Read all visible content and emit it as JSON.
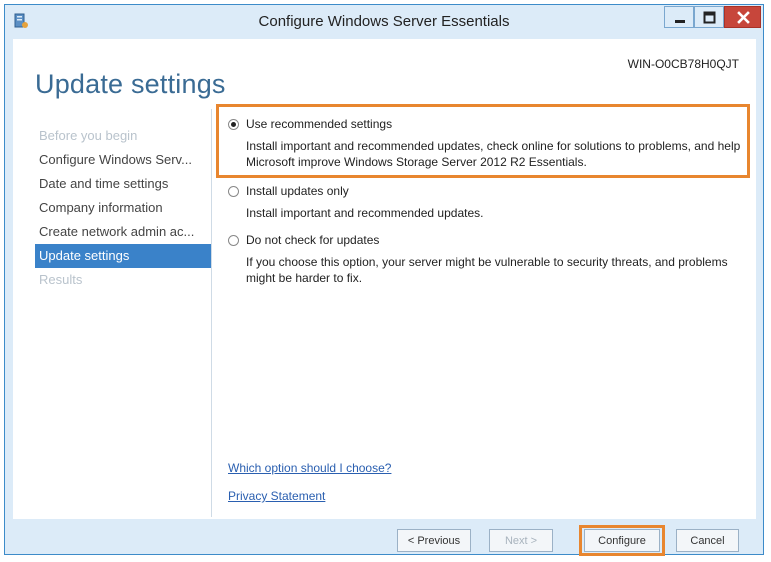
{
  "window": {
    "title": "Configure Windows Server Essentials"
  },
  "header": {
    "page_title": "Update settings",
    "server_name": "WIN-O0CB78H0QJT"
  },
  "nav": {
    "items": [
      {
        "label": "Before you begin",
        "state": "disabled"
      },
      {
        "label": "Configure Windows Serv...",
        "state": "normal"
      },
      {
        "label": "Date and time settings",
        "state": "normal"
      },
      {
        "label": "Company information",
        "state": "normal"
      },
      {
        "label": "Create network admin ac...",
        "state": "normal"
      },
      {
        "label": "Update settings",
        "state": "active"
      },
      {
        "label": "Results",
        "state": "disabled"
      }
    ]
  },
  "options": [
    {
      "label": "Use recommended settings",
      "checked": true,
      "description": "Install important and recommended updates, check online for solutions to problems, and help Microsoft improve Windows Storage Server 2012 R2 Essentials."
    },
    {
      "label": "Install updates only",
      "checked": false,
      "description": "Install important and recommended updates."
    },
    {
      "label": "Do not check for updates",
      "checked": false,
      "description": "If you choose this option, your server might be vulnerable to security threats, and problems might be harder to fix."
    }
  ],
  "links": {
    "which_option": "Which option should I choose?",
    "privacy": "Privacy Statement"
  },
  "footer": {
    "previous": "< Previous",
    "next": "Next >",
    "configure": "Configure",
    "cancel": "Cancel"
  },
  "colors": {
    "accent": "#3a82c9",
    "highlight": "#e8862f",
    "title_text": "#3a6b94"
  },
  "icons": {
    "app": "server-icon",
    "minimize": "minimize-icon",
    "maximize": "maximize-icon",
    "close": "close-icon"
  }
}
